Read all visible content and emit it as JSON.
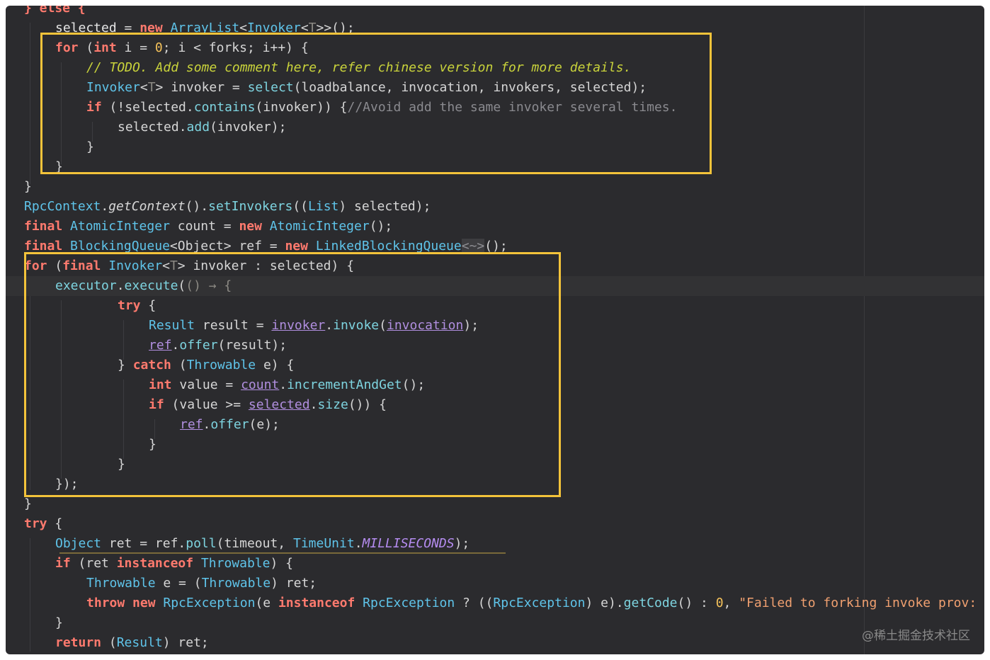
{
  "code": {
    "l0": "} else {",
    "l1a": "selected",
    "l1b": " = ",
    "l1c": "new",
    "l1d": " ArrayList",
    "l1e": "<",
    "l1f": "Invoker",
    "l1g": "<",
    "l1h": "T",
    "l1i": ">>();",
    "l2a": "for",
    "l2b": " (",
    "l2c": "int",
    "l2d": " i",
    "l2e": " = ",
    "l2f": "0",
    "l2g": "; i < forks; i++) {",
    "l3": "// TODO. Add some comment here, refer chinese version for more details.",
    "l4a": "Invoker",
    "l4b": "<",
    "l4c": "T",
    "l4d": "> invoker = ",
    "l4e": "select",
    "l4f": "(loadbalance, invocation, invokers, selected);",
    "l5a": "if",
    "l5b": " (!selected.",
    "l5c": "contains",
    "l5d": "(invoker)) {",
    "l5e": "//Avoid add the same invoker several times.",
    "l6a": "selected.",
    "l6b": "add",
    "l6c": "(invoker);",
    "l7": "}",
    "l8": "}",
    "l9": "}",
    "l10a": "RpcContext",
    "l10b": ".",
    "l10c": "getContext",
    "l10d": "().",
    "l10e": "setInvokers",
    "l10f": "((",
    "l10g": "List",
    "l10h": ") selected);",
    "l11a": "final",
    "l11b": " AtomicInteger",
    "l11c": " count = ",
    "l11d": "new",
    "l11e": " AtomicInteger",
    "l11f": "();",
    "l12a": "final",
    "l12b": " BlockingQueue",
    "l12c": "<Object> ref = ",
    "l12d": "new",
    "l12e": " LinkedBlockingQueue",
    "l12f": "<~>",
    "l12g": "();",
    "l13a": "for",
    "l13b": " (",
    "l13c": "final",
    "l13d": " Invoker",
    "l13e": "<",
    "l13f": "T",
    "l13g": "> invoker : selected) {",
    "l14a": "executor",
    "l14b": ".",
    "l14c": "execute",
    "l14d": "(",
    "l14e": "() → {",
    "l15a": "try",
    "l15b": " {",
    "l16a": "Result",
    "l16b": " result = ",
    "l16c": "invoker",
    "l16d": ".",
    "l16e": "invoke",
    "l16f": "(",
    "l16g": "invocation",
    "l16h": ");",
    "l17a": "ref",
    "l17b": ".",
    "l17c": "offer",
    "l17d": "(result);",
    "l18a": "} ",
    "l18b": "catch",
    "l18c": " (",
    "l18d": "Throwable",
    "l18e": " e) {",
    "l19a": "int",
    "l19b": " value = ",
    "l19c": "count",
    "l19d": ".",
    "l19e": "incrementAndGet",
    "l19f": "();",
    "l20a": "if",
    "l20b": " (value >= ",
    "l20c": "selected",
    "l20d": ".",
    "l20e": "size",
    "l20f": "()) {",
    "l21a": "ref",
    "l21b": ".",
    "l21c": "offer",
    "l21d": "(e);",
    "l22": "}",
    "l23": "}",
    "l24": "});",
    "l25": "}",
    "l26a": "try",
    "l26b": " {",
    "l27a": "Object",
    "l27b": " ret = ref.",
    "l27c": "poll",
    "l27d": "(timeout, ",
    "l27e": "TimeUnit",
    "l27f": ".",
    "l27g": "MILLISECONDS",
    "l27h": ");",
    "l28a": "if",
    "l28b": " (ret ",
    "l28c": "instanceof",
    "l28d": " Throwable",
    "l28e": ") {",
    "l29a": "Throwable",
    "l29b": " e = (",
    "l29c": "Throwable",
    "l29d": ") ret;",
    "l30a": "throw",
    "l30b": " ",
    "l30c": "new",
    "l30d": " RpcException",
    "l30e": "(e ",
    "l30f": "instanceof",
    "l30g": " RpcException",
    "l30h": " ? ((",
    "l30i": "RpcException",
    "l30j": ") e).",
    "l30k": "getCode",
    "l30l": "() : ",
    "l30m": "0",
    "l30n": ", ",
    "l30o": "\"Failed to forking invoke prov:",
    "l31": "}",
    "l32a": "return",
    "l32b": " (",
    "l32c": "Result",
    "l32d": ") ret;"
  },
  "watermark": "@稀土掘金技术社区",
  "colors": {
    "background": "#2b2b2e",
    "highlight_box": "#f3c33a",
    "keyword": "#ff7a6e",
    "type": "#5fc4ea",
    "comment_todo": "#c9d33b"
  }
}
